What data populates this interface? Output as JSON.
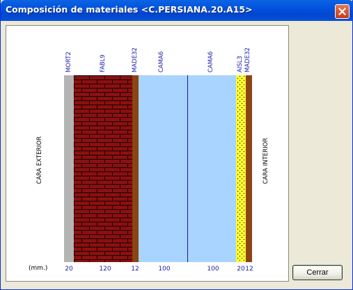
{
  "window": {
    "title": "Composición de materiales <C.PERSIANA.20.A15>"
  },
  "icons": {
    "close": "close-icon"
  },
  "colors": {
    "title_bar": "#0054e3",
    "label_blue": "#1a1aa8",
    "mortar": "#b4b4b4",
    "brick": "#8b1010",
    "brick_mortar": "#1a0000",
    "wood": "#8b4513",
    "air_chamber": "#a8d4ff",
    "divider": "#1a1a8c",
    "insulation": "#ffff33"
  },
  "diagram": {
    "face_exterior": "CARA EXTERIOR",
    "face_interior": "CARA INTERIOR",
    "units_label": "(mm.)",
    "layers": [
      {
        "code": "MORT2",
        "thickness": "20",
        "material": "mortar"
      },
      {
        "code": "FABL9",
        "thickness": "120",
        "material": "brick"
      },
      {
        "code": "MADE32",
        "thickness": "12",
        "material": "wood"
      },
      {
        "code": "CAMA6",
        "thickness": "100",
        "material": "air_chamber"
      },
      {
        "code": "CAMA6",
        "thickness": "100",
        "material": "air_chamber"
      },
      {
        "code": "AISL3",
        "thickness": "20",
        "material": "insulation"
      },
      {
        "code": "MADE32",
        "thickness": "12",
        "material": "wood"
      }
    ]
  },
  "buttons": {
    "close_label": "Cerrar"
  }
}
